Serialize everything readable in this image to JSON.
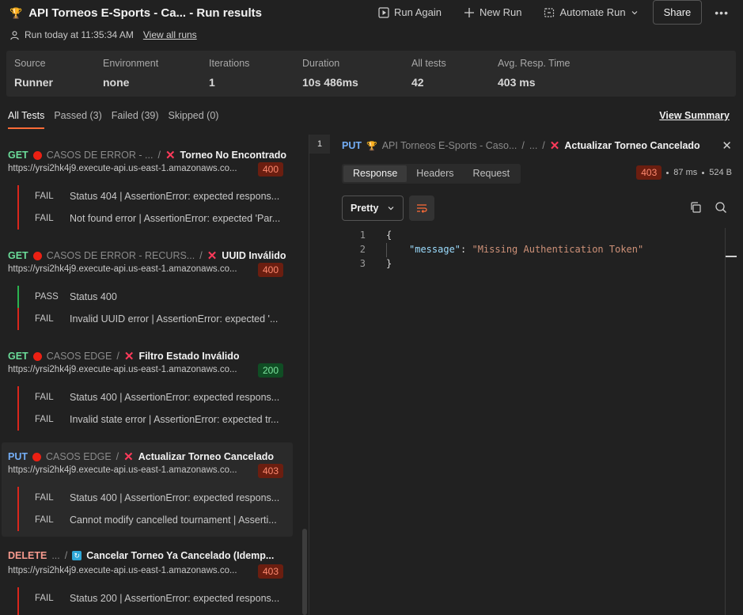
{
  "header": {
    "title": "API Torneos E-Sports - Ca... - Run results",
    "run_info": "Run today at 11:35:34 AM",
    "view_all_runs": "View all runs",
    "actions": {
      "run_again": "Run Again",
      "new_run": "New Run",
      "automate_run": "Automate Run",
      "share": "Share",
      "more": "•••"
    }
  },
  "stats": [
    {
      "label": "Source",
      "value": "Runner"
    },
    {
      "label": "Environment",
      "value": "none"
    },
    {
      "label": "Iterations",
      "value": "1"
    },
    {
      "label": "Duration",
      "value": "10s 486ms"
    },
    {
      "label": "All tests",
      "value": "42"
    },
    {
      "label": "Avg. Resp. Time",
      "value": "403 ms"
    }
  ],
  "tabs": {
    "all": "All Tests",
    "passed": "Passed (3)",
    "failed": "Failed (39)",
    "skipped": "Skipped (0)",
    "view_summary": "View Summary"
  },
  "requests": [
    {
      "method": "GET",
      "folder": "CASOS DE ERROR - ...",
      "name": "Torneo No Encontrado",
      "url": "https://yrsi2hk4j9.execute-api.us-east-1.amazonaws.co...",
      "status": "400",
      "results": [
        {
          "state": "FAIL",
          "message": "Status 404 | AssertionError: expected respons..."
        },
        {
          "state": "FAIL",
          "message": "Not found error | AssertionError: expected 'Par..."
        }
      ]
    },
    {
      "method": "GET",
      "folder": "CASOS DE ERROR - RECURS...",
      "name": "UUID Inválido",
      "url": "https://yrsi2hk4j9.execute-api.us-east-1.amazonaws.co...",
      "status": "400",
      "results": [
        {
          "state": "PASS",
          "message": "Status 400"
        },
        {
          "state": "FAIL",
          "message": "Invalid UUID error | AssertionError: expected '..."
        }
      ]
    },
    {
      "method": "GET",
      "folder": "CASOS EDGE",
      "name": "Filtro Estado Inválido",
      "url": "https://yrsi2hk4j9.execute-api.us-east-1.amazonaws.co...",
      "status": "200",
      "results": [
        {
          "state": "FAIL",
          "message": "Status 400 | AssertionError: expected respons..."
        },
        {
          "state": "FAIL",
          "message": "Invalid state error | AssertionError: expected tr..."
        }
      ]
    },
    {
      "method": "PUT",
      "folder": "CASOS EDGE",
      "name": "Actualizar Torneo Cancelado",
      "url": "https://yrsi2hk4j9.execute-api.us-east-1.amazonaws.co...",
      "status": "403",
      "results": [
        {
          "state": "FAIL",
          "message": "Status 400 | AssertionError: expected respons..."
        },
        {
          "state": "FAIL",
          "message": "Cannot modify cancelled tournament | Asserti..."
        }
      ]
    },
    {
      "method": "DELETE",
      "folder": "...",
      "name": "Cancelar Torneo Ya Cancelado (Idemp...",
      "url": "https://yrsi2hk4j9.execute-api.us-east-1.amazonaws.co...",
      "status": "403",
      "results": [
        {
          "state": "FAIL",
          "message": "Status 200 | AssertionError: expected respons..."
        }
      ]
    }
  ],
  "detail": {
    "tab_number": "1",
    "method": "PUT",
    "collection": "API Torneos E-Sports - Caso...",
    "ellipsis": "...",
    "name": "Actualizar Torneo Cancelado",
    "response_tabs": [
      "Response",
      "Headers",
      "Request"
    ],
    "status": "403",
    "time": "87 ms",
    "size": "524 B",
    "format": "Pretty",
    "code_lines": [
      "1",
      "2",
      "3"
    ],
    "body": {
      "open": "{",
      "key": "\"message\"",
      "colon": ": ",
      "value": "\"Missing Authentication Token\"",
      "close": "}"
    }
  }
}
